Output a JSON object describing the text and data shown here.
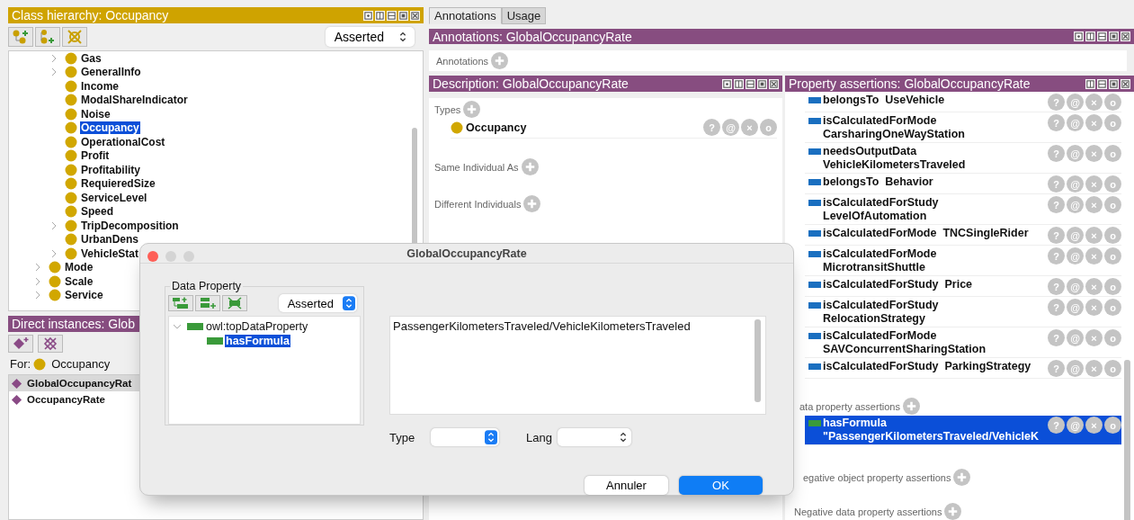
{
  "class_hierarchy": {
    "title": "Class hierarchy: Occupancy",
    "view": "Asserted",
    "nested_items": [
      {
        "label": "Gas",
        "expandable": true,
        "selected": false
      },
      {
        "label": "GeneralInfo",
        "expandable": true,
        "selected": false
      },
      {
        "label": "Income",
        "expandable": false,
        "selected": false
      },
      {
        "label": "ModalShareIndicator",
        "expandable": false,
        "selected": false
      },
      {
        "label": "Noise",
        "expandable": false,
        "selected": false
      },
      {
        "label": "Occupancy",
        "expandable": false,
        "selected": true
      },
      {
        "label": "OperationalCost",
        "expandable": false,
        "selected": false
      },
      {
        "label": "Profit",
        "expandable": false,
        "selected": false
      },
      {
        "label": "Profitability",
        "expandable": false,
        "selected": false
      },
      {
        "label": "RequieredSize",
        "expandable": false,
        "selected": false
      },
      {
        "label": "ServiceLevel",
        "expandable": false,
        "selected": false
      },
      {
        "label": "Speed",
        "expandable": false,
        "selected": false
      },
      {
        "label": "TripDecomposition",
        "expandable": true,
        "selected": false
      },
      {
        "label": "UrbanDens",
        "expandable": false,
        "selected": false
      },
      {
        "label": "VehicleStat",
        "expandable": true,
        "selected": false
      }
    ],
    "items": [
      {
        "label": "Mode",
        "expandable": true,
        "selected": false
      },
      {
        "label": "Scale",
        "expandable": true,
        "selected": false
      },
      {
        "label": "Service",
        "expandable": true,
        "selected": false
      }
    ]
  },
  "direct_instances": {
    "title": "Direct instances: Glob",
    "for_label": "For:",
    "for_class": "Occupancy",
    "items": [
      {
        "label": "GlobalOccupancyRat",
        "selected": true
      },
      {
        "label": "OccupancyRate",
        "selected": false
      }
    ]
  },
  "tabs": [
    {
      "label": "Annotations",
      "selected": true
    },
    {
      "label": "Usage",
      "selected": false
    }
  ],
  "annotations": {
    "title": "Annotations: GlobalOccupancyRate",
    "section": "Annotations"
  },
  "description": {
    "title": "Description: GlobalOccupancyRate",
    "types_label": "Types",
    "types": [
      {
        "label": "Occupancy",
        "actions": [
          "?",
          "@",
          "×",
          "o"
        ]
      }
    ],
    "same_label": "Same Individual As",
    "different_label": "Different Individuals"
  },
  "property_assertions": {
    "title": "Property assertions: GlobalOccupancyRate",
    "object_assertions": [
      {
        "property": "belongsTo",
        "value": "UseVehicle",
        "wrapped": false,
        "actions": [
          "?",
          "@",
          "×",
          "o"
        ]
      },
      {
        "property": "isCalculatedForMode",
        "value": "CarsharingOneWayStation",
        "wrapped": true,
        "actions": [
          "?",
          "@",
          "×",
          "o"
        ]
      },
      {
        "property": "needsOutputData",
        "value": "VehicleKilometersTraveled",
        "wrapped": true,
        "actions": [
          "?",
          "@",
          "×",
          "o"
        ]
      },
      {
        "property": "belongsTo",
        "value": "Behavior",
        "wrapped": false,
        "actions": [
          "?",
          "@",
          "×",
          "o"
        ]
      },
      {
        "property": "isCalculatedForStudy",
        "value": "LevelOfAutomation",
        "wrapped": true,
        "actions": [
          "?",
          "@",
          "×",
          "o"
        ]
      },
      {
        "property": "isCalculatedForMode",
        "value": "TNCSingleRider",
        "wrapped": false,
        "actions": [
          "?",
          "@",
          "×",
          "o"
        ]
      },
      {
        "property": "isCalculatedForMode",
        "value": "MicrotransitShuttle",
        "wrapped": true,
        "actions": [
          "?",
          "@",
          "×",
          "o"
        ]
      },
      {
        "property": "isCalculatedForStudy",
        "value": "Price",
        "wrapped": false,
        "actions": [
          "?",
          "@",
          "×",
          "o"
        ]
      },
      {
        "property": "isCalculatedForStudy",
        "value": "RelocationStrategy",
        "wrapped": true,
        "actions": [
          "?",
          "@",
          "×",
          "o"
        ]
      },
      {
        "property": "isCalculatedForMode",
        "value": "SAVConcurrentSharingStation",
        "wrapped": true,
        "actions": [
          "?",
          "@",
          "×",
          "o"
        ]
      },
      {
        "property": "isCalculatedForStudy",
        "value": "ParkingStrategy",
        "wrapped": false,
        "actions": [
          "?",
          "@",
          "×",
          "o"
        ]
      }
    ],
    "data_section": "ata property assertions",
    "data_assertions": [
      {
        "property": "hasFormula",
        "value": "\"PassengerKilometersTraveled/VehicleK",
        "selected": true,
        "actions": [
          "?",
          "@",
          "×",
          "o"
        ]
      }
    ],
    "negative_object_section": "egative object property assertions",
    "negative_data_section": "Negative data property assertions"
  },
  "dialog": {
    "title": "GlobalOccupancyRate",
    "group_label": "Data Property",
    "view": "Asserted",
    "tree": [
      {
        "label": "owl:topDataProperty",
        "selected": false,
        "expanded": true,
        "children": [
          {
            "label": "hasFormula",
            "selected": true
          }
        ]
      }
    ],
    "value": "PassengerKilometersTraveled/VehicleKilometersTraveled",
    "type_label": "Type",
    "lang_label": "Lang",
    "buttons": [
      {
        "label": "Annuler",
        "kind": "cancel"
      },
      {
        "label": "OK",
        "kind": "default"
      }
    ]
  }
}
